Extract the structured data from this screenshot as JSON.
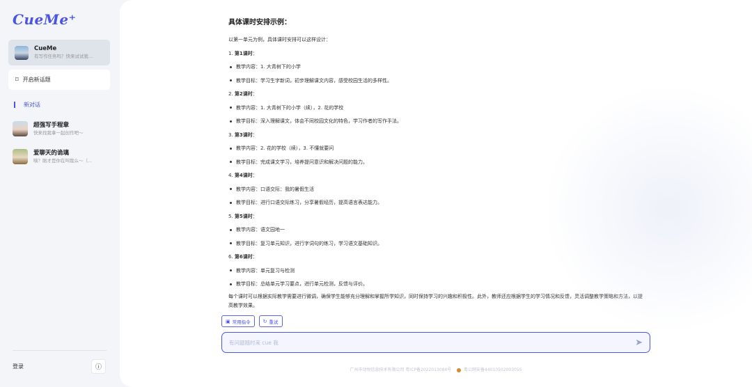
{
  "app": {
    "logo": "CueMe⁺"
  },
  "sidebar": {
    "bot": {
      "name": "CueMe",
      "sub": "有写作任务吗？快来试试我..."
    },
    "new_topic": "开启新话题",
    "active": "新对话",
    "conversations": [
      {
        "title": "超强写手程章",
        "sub": "快来找我拿一起创作吧～"
      },
      {
        "title": "爱聊天的诡璃",
        "sub": "嗔？刚才是你在叫我么～（..."
      }
    ],
    "login": "登录",
    "info_icon": "info-icon"
  },
  "message": {
    "title": "具体课时安排示例：",
    "intro": "以第一单元为例，具体课时安排可以这样设计：",
    "lessons": [
      {
        "num": "1.",
        "label": "第1课时",
        "content": "教学内容：1. 大青树下的小学",
        "goal": "教学目标：学习生字新词，初步理解课文内容，感受校园生活的多样性。"
      },
      {
        "num": "2.",
        "label": "第2课时",
        "content": "教学内容：1. 大青树下的小学（续），2. 花的学校",
        "goal": "教学目标：深入理解课文，体会不同校园文化的特色，学习作者的写作手法。"
      },
      {
        "num": "3.",
        "label": "第3课时",
        "content": "教学内容：2. 花的学校（续），3. 不懂就要问",
        "goal": "教学目标：完成课文学习，培养提问意识和解决问题的能力。"
      },
      {
        "num": "4.",
        "label": "第4课时",
        "content": "教学内容：口语交际：我的暑假生活",
        "goal": "教学目标：进行口语交际练习，分享暑假经历，提高语言表达能力。"
      },
      {
        "num": "5.",
        "label": "第5课时",
        "content": "教学内容：语文园地一",
        "goal": "教学目标：复习单元知识，进行字词句的练习，学习语文基础知识。"
      },
      {
        "num": "6.",
        "label": "第6课时",
        "content": "教学内容：单元复习与检测",
        "goal": "教学目标：总结单元学习要点，进行单元检测，反馈与评价。"
      }
    ],
    "summary": "每个课时可以根据实际教学需要进行微调，确保学生能够充分理解和掌握所学知识，同时保持学习的兴趣和积极性。此外，教师还应根据学生的学习情况和反馈，灵活调整教学策略和方法，以提高教学效果。"
  },
  "actions": {
    "commands": "常用指令",
    "retry": "重试"
  },
  "input": {
    "placeholder": "有问题随时来 cue 我",
    "value": ""
  },
  "footer": {
    "company": "广州市动悦信息技术有限公司 粤ICP备2022013084号",
    "police": "粤公网安备44010502003055"
  },
  "colors": {
    "accent": "#4a55e8",
    "sidebar_bg": "#f3f5f9",
    "main_bg": "#ffffff"
  }
}
